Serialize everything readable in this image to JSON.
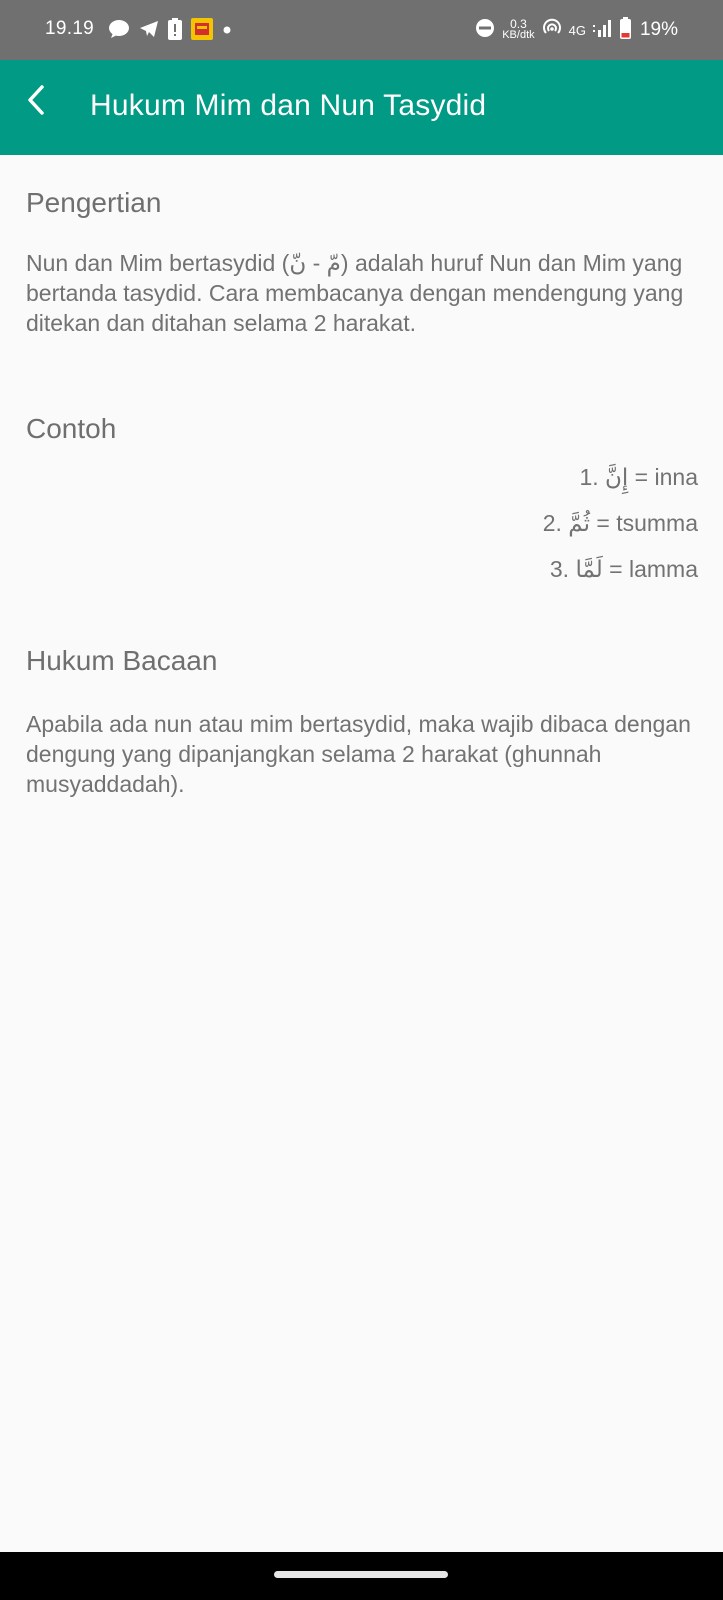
{
  "status_bar": {
    "time": "19.19",
    "speed_value": "0.3",
    "speed_unit": "KB/dtk",
    "network": "4G",
    "battery": "19%"
  },
  "app_bar": {
    "title": "Hukum Mim dan Nun Tasydid"
  },
  "sections": {
    "pengertian": {
      "heading": "Pengertian",
      "body": "Nun dan Mim bertasydid (مّ - نّ) adalah huruf Nun dan Mim yang bertanda tasydid. Cara membacanya dengan mendengung yang ditekan dan ditahan selama 2 harakat."
    },
    "contoh": {
      "heading": "Contoh",
      "items": [
        "1. إِنَّ = inna",
        "2. ثُمَّ = tsumma",
        "3. لَمَّا = lamma"
      ]
    },
    "hukum_bacaan": {
      "heading": "Hukum Bacaan",
      "body": "Apabila ada nun atau mim bertasydid, maka wajib dibaca dengan dengung yang dipanjangkan selama 2 harakat (ghunnah musyaddadah)."
    }
  },
  "colors": {
    "app_bar": "#009a85",
    "status_bar": "#707070",
    "background": "#fafafa",
    "text": "#727272",
    "battery_low": "#e53935"
  }
}
